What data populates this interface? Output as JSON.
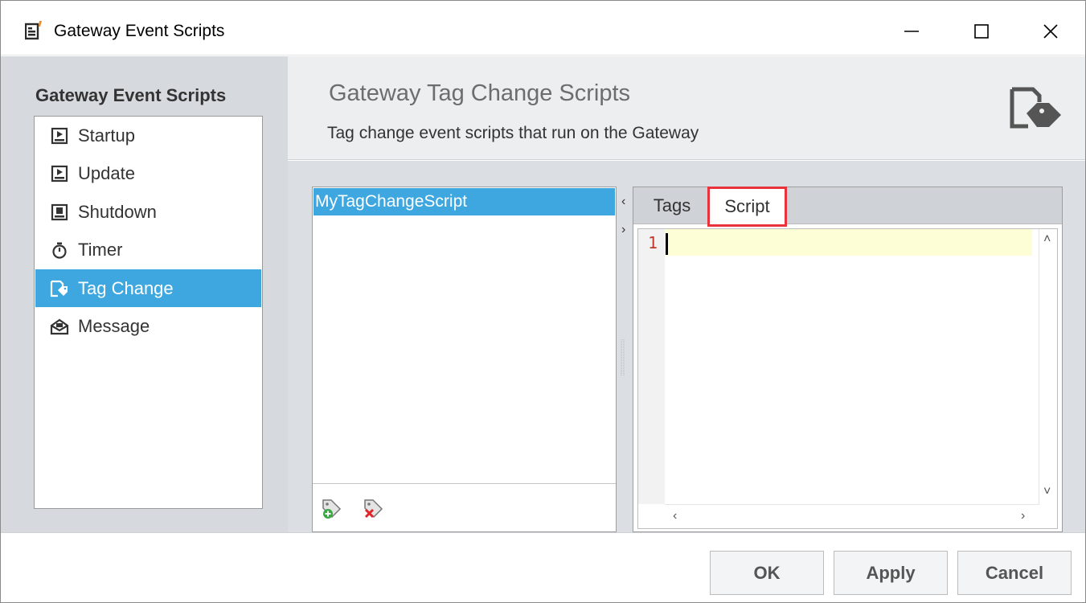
{
  "window": {
    "title": "Gateway Event Scripts",
    "controls": [
      "minimize",
      "maximize",
      "close"
    ]
  },
  "sidebar": {
    "heading": "Gateway Event Scripts",
    "items": [
      {
        "label": "Startup",
        "icon": "play-page-icon",
        "selected": false
      },
      {
        "label": "Update",
        "icon": "play-page-icon",
        "selected": false
      },
      {
        "label": "Shutdown",
        "icon": "stop-page-icon",
        "selected": false
      },
      {
        "label": "Timer",
        "icon": "stopwatch-icon",
        "selected": false
      },
      {
        "label": "Tag Change",
        "icon": "tag-page-icon",
        "selected": true
      },
      {
        "label": "Message",
        "icon": "envelope-icon",
        "selected": false
      }
    ]
  },
  "header": {
    "title": "Gateway Tag Change Scripts",
    "subtitle": "Tag change event scripts that run on the Gateway",
    "icon": "tag-page-icon"
  },
  "scripts": {
    "items": [
      {
        "label": "MyTagChangeScript",
        "selected": true
      }
    ],
    "toolbar": {
      "add_icon": "add-tag-icon",
      "delete_icon": "delete-tag-icon"
    }
  },
  "editor": {
    "tabs": [
      {
        "label": "Tags",
        "selected": false
      },
      {
        "label": "Script",
        "selected": true
      }
    ],
    "line_number": "1",
    "highlight_color": "#e8323c"
  },
  "footer": {
    "ok_label": "OK",
    "apply_label": "Apply",
    "cancel_label": "Cancel"
  },
  "colors": {
    "selection": "#3ea7e0",
    "sidebar_bg": "#d6d9de",
    "header_bg": "#eceef0"
  }
}
